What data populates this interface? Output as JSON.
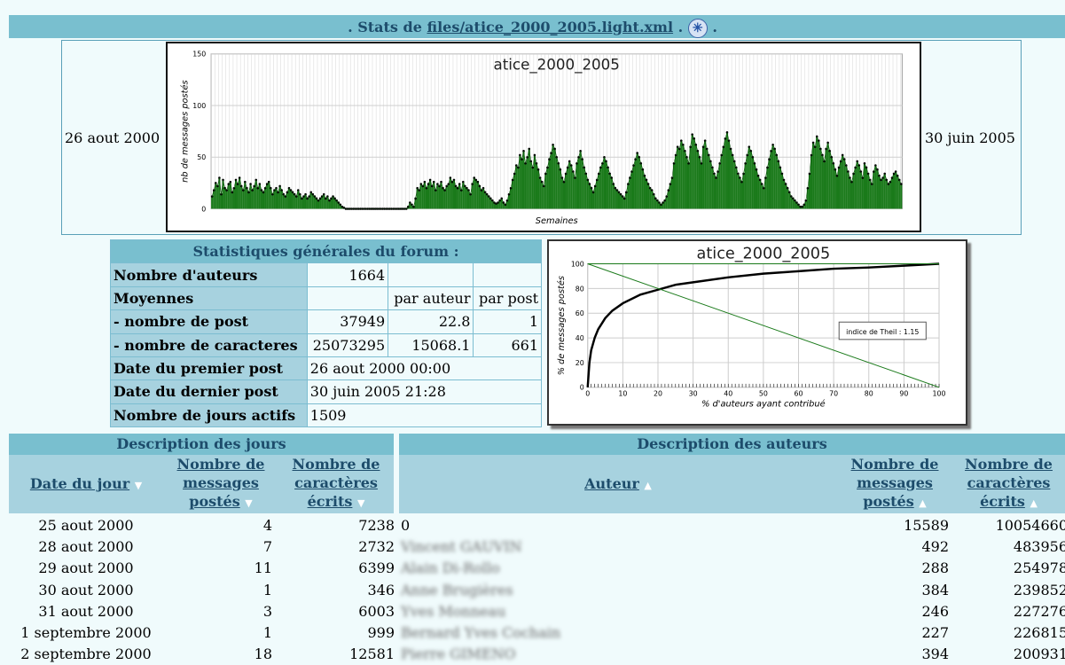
{
  "header": {
    "prefix": ". Stats de ",
    "file_link": "files/atice_2000_2005.light.xml",
    "middle": " . ",
    "suffix": " .",
    "icon": "asterisk-circle-icon"
  },
  "timeline": {
    "start_date": "26 aout 2000",
    "end_date": "30 juin 2005"
  },
  "chart_data": [
    {
      "type": "bar",
      "title": "atice_2000_2005",
      "xlabel": "Semaines",
      "ylabel": "nb de messages postés",
      "ylim": [
        0,
        150
      ],
      "yticks": [
        0,
        50,
        100,
        150
      ],
      "grid": true,
      "series": [
        {
          "values": [
            12,
            18,
            25,
            22,
            30,
            14,
            28,
            20,
            18,
            24,
            26,
            16,
            20,
            28,
            24,
            30,
            22,
            18,
            26,
            20,
            16,
            24,
            18,
            22,
            28,
            20,
            24,
            18,
            16,
            20,
            24,
            26,
            20,
            14,
            18,
            20,
            16,
            22,
            18,
            14,
            12,
            16,
            20,
            18,
            16,
            14,
            12,
            18,
            14,
            10,
            12,
            14,
            10,
            12,
            16,
            14,
            12,
            10,
            8,
            10,
            12,
            14,
            10,
            12,
            8,
            10,
            12,
            10,
            8,
            6,
            4,
            2,
            1,
            0,
            0,
            0,
            0,
            0,
            0,
            0,
            0,
            0,
            0,
            0,
            0,
            0,
            0,
            0,
            0,
            0,
            0,
            0,
            0,
            0,
            0,
            0,
            0,
            0,
            0,
            0,
            0,
            0,
            0,
            0,
            0,
            0,
            0,
            2,
            6,
            4,
            2,
            10,
            20,
            18,
            24,
            22,
            26,
            20,
            24,
            28,
            22,
            26,
            18,
            24,
            22,
            26,
            20,
            18,
            22,
            24,
            30,
            26,
            28,
            22,
            20,
            24,
            18,
            26,
            22,
            20,
            18,
            14,
            24,
            30,
            28,
            26,
            22,
            18,
            20,
            16,
            14,
            12,
            10,
            8,
            6,
            5,
            6,
            8,
            10,
            6,
            4,
            8,
            14,
            20,
            28,
            34,
            42,
            40,
            52,
            48,
            56,
            44,
            50,
            58,
            46,
            40,
            52,
            44,
            38,
            30,
            26,
            22,
            34,
            40,
            48,
            54,
            62,
            58,
            50,
            44,
            38,
            30,
            26,
            34,
            40,
            46,
            42,
            36,
            30,
            44,
            50,
            56,
            48,
            40,
            34,
            28,
            24,
            20,
            16,
            22,
            28,
            34,
            40,
            44,
            50,
            46,
            40,
            34,
            30,
            24,
            20,
            18,
            16,
            14,
            12,
            10,
            16,
            24,
            30,
            36,
            42,
            48,
            54,
            50,
            44,
            38,
            32,
            28,
            24,
            20,
            18,
            14,
            10,
            8,
            6,
            4,
            6,
            8,
            12,
            18,
            24,
            30,
            44,
            52,
            60,
            58,
            66,
            62,
            56,
            50,
            44,
            60,
            72,
            68,
            62,
            56,
            50,
            44,
            60,
            66,
            58,
            52,
            46,
            40,
            34,
            30,
            36,
            44,
            52,
            60,
            68,
            74,
            66,
            58,
            52,
            46,
            40,
            34,
            30,
            26,
            34,
            44,
            52,
            60,
            56,
            50,
            44,
            38,
            32,
            28,
            24,
            20,
            30,
            40,
            48,
            56,
            62,
            58,
            52,
            46,
            40,
            34,
            28,
            24,
            20,
            16,
            12,
            10,
            8,
            6,
            4,
            2,
            2,
            4,
            8,
            20,
            34,
            52,
            64,
            60,
            70,
            66,
            58,
            52,
            46,
            58,
            64,
            56,
            50,
            44,
            38,
            32,
            40,
            46,
            52,
            48,
            42,
            36,
            30,
            26,
            34,
            40,
            46,
            42,
            36,
            30,
            44,
            40,
            34,
            28,
            24,
            36,
            42,
            38,
            32,
            28,
            30,
            34,
            28,
            24,
            26,
            30,
            34,
            36,
            32,
            28,
            24
          ]
        }
      ]
    },
    {
      "type": "line",
      "title": "atice_2000_2005",
      "xlabel": "% d'auteurs ayant contribué",
      "ylabel": "% de messages postés",
      "xlim": [
        0,
        100
      ],
      "ylim": [
        0,
        100
      ],
      "xticks": [
        0,
        10,
        20,
        30,
        40,
        50,
        60,
        70,
        80,
        90,
        100
      ],
      "yticks": [
        0,
        20,
        40,
        60,
        80,
        100
      ],
      "grid": true,
      "annotation": "indice de Theil : 1.15",
      "series": [
        {
          "x": [
            0,
            0.5,
            1,
            2,
            3,
            5,
            7,
            10,
            15,
            20,
            25,
            30,
            40,
            50,
            60,
            70,
            80,
            90,
            100
          ],
          "y": [
            0,
            20,
            30,
            40,
            47,
            56,
            62,
            68,
            75,
            79,
            83,
            85,
            89,
            92,
            94,
            96,
            97,
            98.5,
            100
          ]
        },
        {
          "x": [
            0,
            100
          ],
          "y": [
            100,
            0
          ]
        }
      ]
    }
  ],
  "stats": {
    "caption": "Statistiques générales du forum :",
    "rows": [
      {
        "label": "Nombre d'auteurs",
        "v1": "1664",
        "v2": "",
        "v3": ""
      },
      {
        "label": "Moyennes",
        "v1": "",
        "v2": "par auteur",
        "v3": "par post"
      },
      {
        "label": "- nombre de post",
        "v1": "37949",
        "v2": "22.8",
        "v3": "1"
      },
      {
        "label": "- nombre de caracteres",
        "v1": "25073295",
        "v2": "15068.1",
        "v3": "661"
      },
      {
        "label": "Date du premier post",
        "v1": "26 aout 2000 00:00",
        "v2": "",
        "v3": ""
      },
      {
        "label": "Date du dernier post",
        "v1": "30 juin 2005 21:28",
        "v2": "",
        "v3": ""
      },
      {
        "label": "Nombre de jours actifs",
        "v1": "1509",
        "v2": "",
        "v3": ""
      }
    ]
  },
  "days": {
    "caption": "Description des jours",
    "headers": [
      {
        "label": "Date du jour",
        "sort": "▼"
      },
      {
        "l1": "Nombre de",
        "l2": "messages",
        "l3": "postés",
        "sort": "▼"
      },
      {
        "l1": "Nombre de",
        "l2": "caractères",
        "l3": "écrits",
        "sort": "▼"
      }
    ],
    "rows": [
      {
        "date": "25 aout 2000",
        "msgs": "4",
        "chars": "7238"
      },
      {
        "date": "28 aout 2000",
        "msgs": "7",
        "chars": "2732"
      },
      {
        "date": "29 aout 2000",
        "msgs": "11",
        "chars": "6399"
      },
      {
        "date": "30 aout 2000",
        "msgs": "1",
        "chars": "346"
      },
      {
        "date": "31 aout 2000",
        "msgs": "3",
        "chars": "6003"
      },
      {
        "date": "1 septembre 2000",
        "msgs": "1",
        "chars": "999"
      },
      {
        "date": "2 septembre 2000",
        "msgs": "18",
        "chars": "12581"
      }
    ]
  },
  "authors": {
    "caption": "Description des auteurs",
    "headers": [
      {
        "label": "Auteur",
        "sort": "▲"
      },
      {
        "l1": "Nombre de",
        "l2": "messages",
        "l3": "postés",
        "sort": "▲"
      },
      {
        "l1": "Nombre de",
        "l2": "caractères",
        "l3": "écrits",
        "sort": "▲"
      }
    ],
    "rows": [
      {
        "name": "0",
        "msgs": "15589",
        "chars": "10054660"
      },
      {
        "name": "Vincent GAUVIN",
        "msgs": "492",
        "chars": "483956"
      },
      {
        "name": "Alain Di-Rollo",
        "msgs": "288",
        "chars": "254978"
      },
      {
        "name": "Anne Brugières",
        "msgs": "384",
        "chars": "239852"
      },
      {
        "name": "Yves Monneau",
        "msgs": "246",
        "chars": "227276"
      },
      {
        "name": "Bernard Yves Cochain",
        "msgs": "227",
        "chars": "226815"
      },
      {
        "name": "Pierre GIMENO",
        "msgs": "394",
        "chars": "200931"
      }
    ]
  }
}
